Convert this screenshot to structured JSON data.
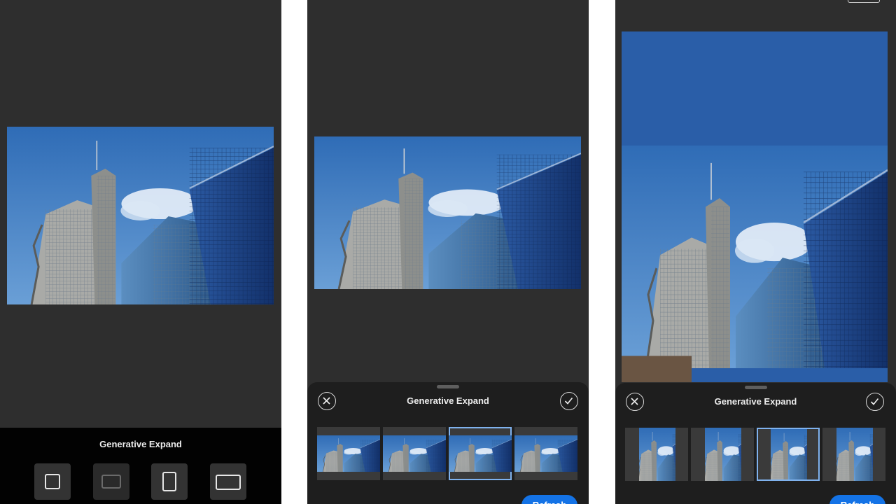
{
  "screens": [
    {
      "panel_title": "Generative Expand",
      "aspect_buttons": [
        {
          "icon": "square-ratio-icon",
          "enabled": true
        },
        {
          "icon": "original-ratio-icon",
          "enabled": false
        },
        {
          "icon": "portrait-ratio-icon",
          "enabled": true
        },
        {
          "icon": "landscape-ratio-icon",
          "enabled": true
        }
      ]
    },
    {
      "sheet_title": "Generative Expand",
      "refresh_label": "Refresh",
      "variation_count": 4,
      "selected_variation": 3
    },
    {
      "sheet_title": "Generative Expand",
      "refresh_label": "Refresh",
      "variation_count": 4,
      "selected_variation": 3
    }
  ],
  "colors": {
    "accent": "#1473e6",
    "selection": "#7fb2ee",
    "canvas": "#2e2e2e",
    "sheet": "#1e1e1e"
  }
}
